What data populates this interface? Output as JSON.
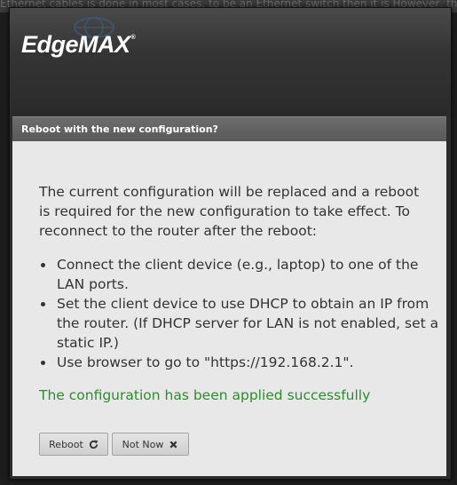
{
  "app": {
    "logo_text": "EdgeMAX",
    "logo_mark": "®"
  },
  "background": {
    "partial_text": "Ethernet cables is done in most cases, to be an Ethernet switch then it is  However, there"
  },
  "dialog": {
    "title": "Reboot with the new configuration?",
    "message": "The current configuration will be replaced and a reboot is required for the new configuration to take effect. To reconnect to the router after the reboot:",
    "steps": [
      "Connect the client device (e.g., laptop) to one of the LAN ports.",
      "Set the client device to use DHCP to obtain an IP from the router. (If DHCP server for LAN is not enabled, set a static IP.)",
      "Use browser to go to \"https://192.168.2.1\"."
    ],
    "status": "The configuration has been applied successfully",
    "buttons": {
      "reboot": "Reboot",
      "not_now": "Not Now"
    }
  },
  "colors": {
    "success": "#2e8b2e",
    "title_bar": "#5f5f5f",
    "dialog_bg": "#e8e8e8"
  },
  "icons": {
    "reboot": "refresh-icon",
    "not_now": "close-icon"
  }
}
